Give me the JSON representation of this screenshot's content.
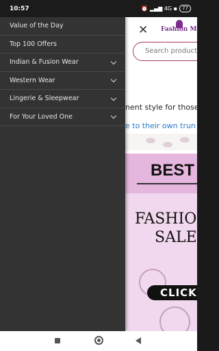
{
  "status_bar": {
    "time": "10:57",
    "icons_text": "⏰ ▂▄▆ 4G ▪",
    "battery": "77"
  },
  "website": {
    "close_glyph": "✕",
    "logo_text": "Fashion Me",
    "search_placeholder": "Search products",
    "ticker_line1": "nent style for those w",
    "ticker_line2": "e to their own trun",
    "banner": {
      "best": "BEST",
      "fashion": "FASHIO",
      "sale": "SALE",
      "click": "CLICK"
    }
  },
  "drawer": {
    "items": [
      {
        "label": "Value of the Day",
        "expandable": false
      },
      {
        "label": "Top 100 Offers",
        "expandable": false
      },
      {
        "label": "Indian & Fusion Wear",
        "expandable": true
      },
      {
        "label": "Western Wear",
        "expandable": true
      },
      {
        "label": "Lingerie & Sleepwear",
        "expandable": true
      },
      {
        "label": "For Your Loved One",
        "expandable": true
      }
    ]
  },
  "colors": {
    "drawer_bg": "#333333",
    "accent": "#a33b68",
    "banner_pink": "#e6b7de",
    "link_blue": "#2979c9"
  }
}
